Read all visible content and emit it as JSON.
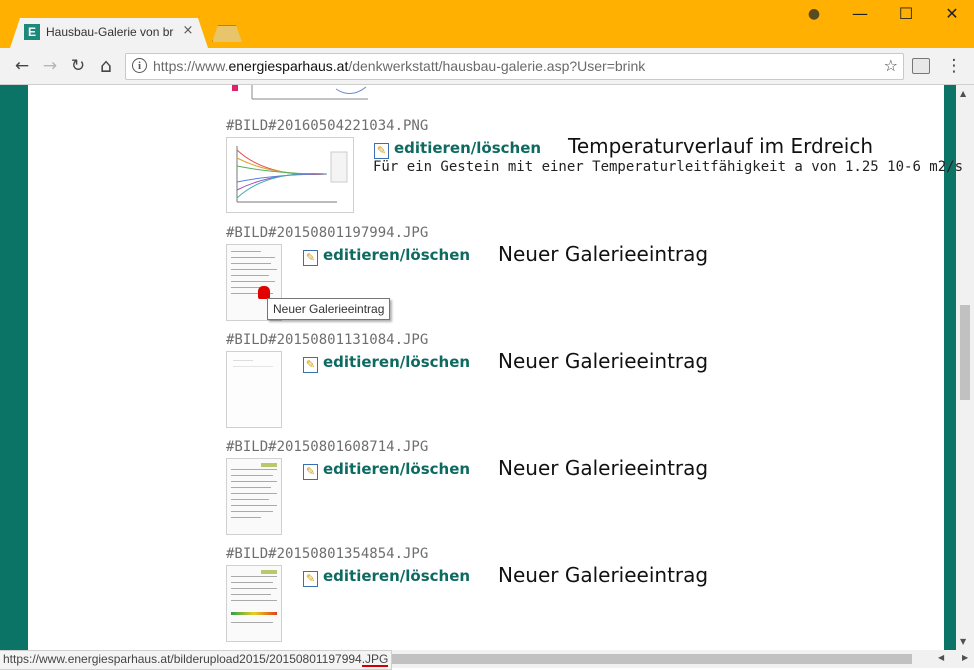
{
  "browser": {
    "tab_title": "Hausbau-Galerie von brink",
    "tab_favicon_letter": "E",
    "tab_close": "×",
    "window_controls": {
      "account": "●",
      "minimize": "—",
      "maximize": "☐",
      "close": "✕"
    },
    "nav": {
      "back": "←",
      "forward": "→",
      "reload": "↻",
      "home": "⌂",
      "menu": "⋮"
    },
    "url_prefix": "https://www.",
    "url_domain": "energiesparhaus.at",
    "url_path": "/denkwerkstatt/hausbau-galerie.asp?User=brink",
    "star": "☆"
  },
  "gallery": {
    "edit_label": "editieren/löschen",
    "entries": [
      {
        "id": "#BILD#20160504221034.PNG",
        "title": "Temperaturverlauf im Erdreich",
        "description": "Für ein Gestein mit einer Temperaturleitfähigkeit a von 1.25 10-6 m2/s"
      },
      {
        "id": "#BILD#20150801197994.JPG",
        "title": "Neuer Galerieeintrag"
      },
      {
        "id": "#BILD#20150801131084.JPG",
        "title": "Neuer Galerieeintrag"
      },
      {
        "id": "#BILD#20150801608714.JPG",
        "title": "Neuer Galerieeintrag"
      },
      {
        "id": "#BILD#20150801354854.JPG",
        "title": "Neuer Galerieeintrag"
      }
    ]
  },
  "tooltip": "Neuer Galerieeintrag",
  "status_url": "https://www.energiesparhaus.at/bilderupload2015/20150801197994.JPG",
  "colors": {
    "titlebar": "#FFB000",
    "side_panel": "#0b7466",
    "link": "#0e6a61"
  }
}
